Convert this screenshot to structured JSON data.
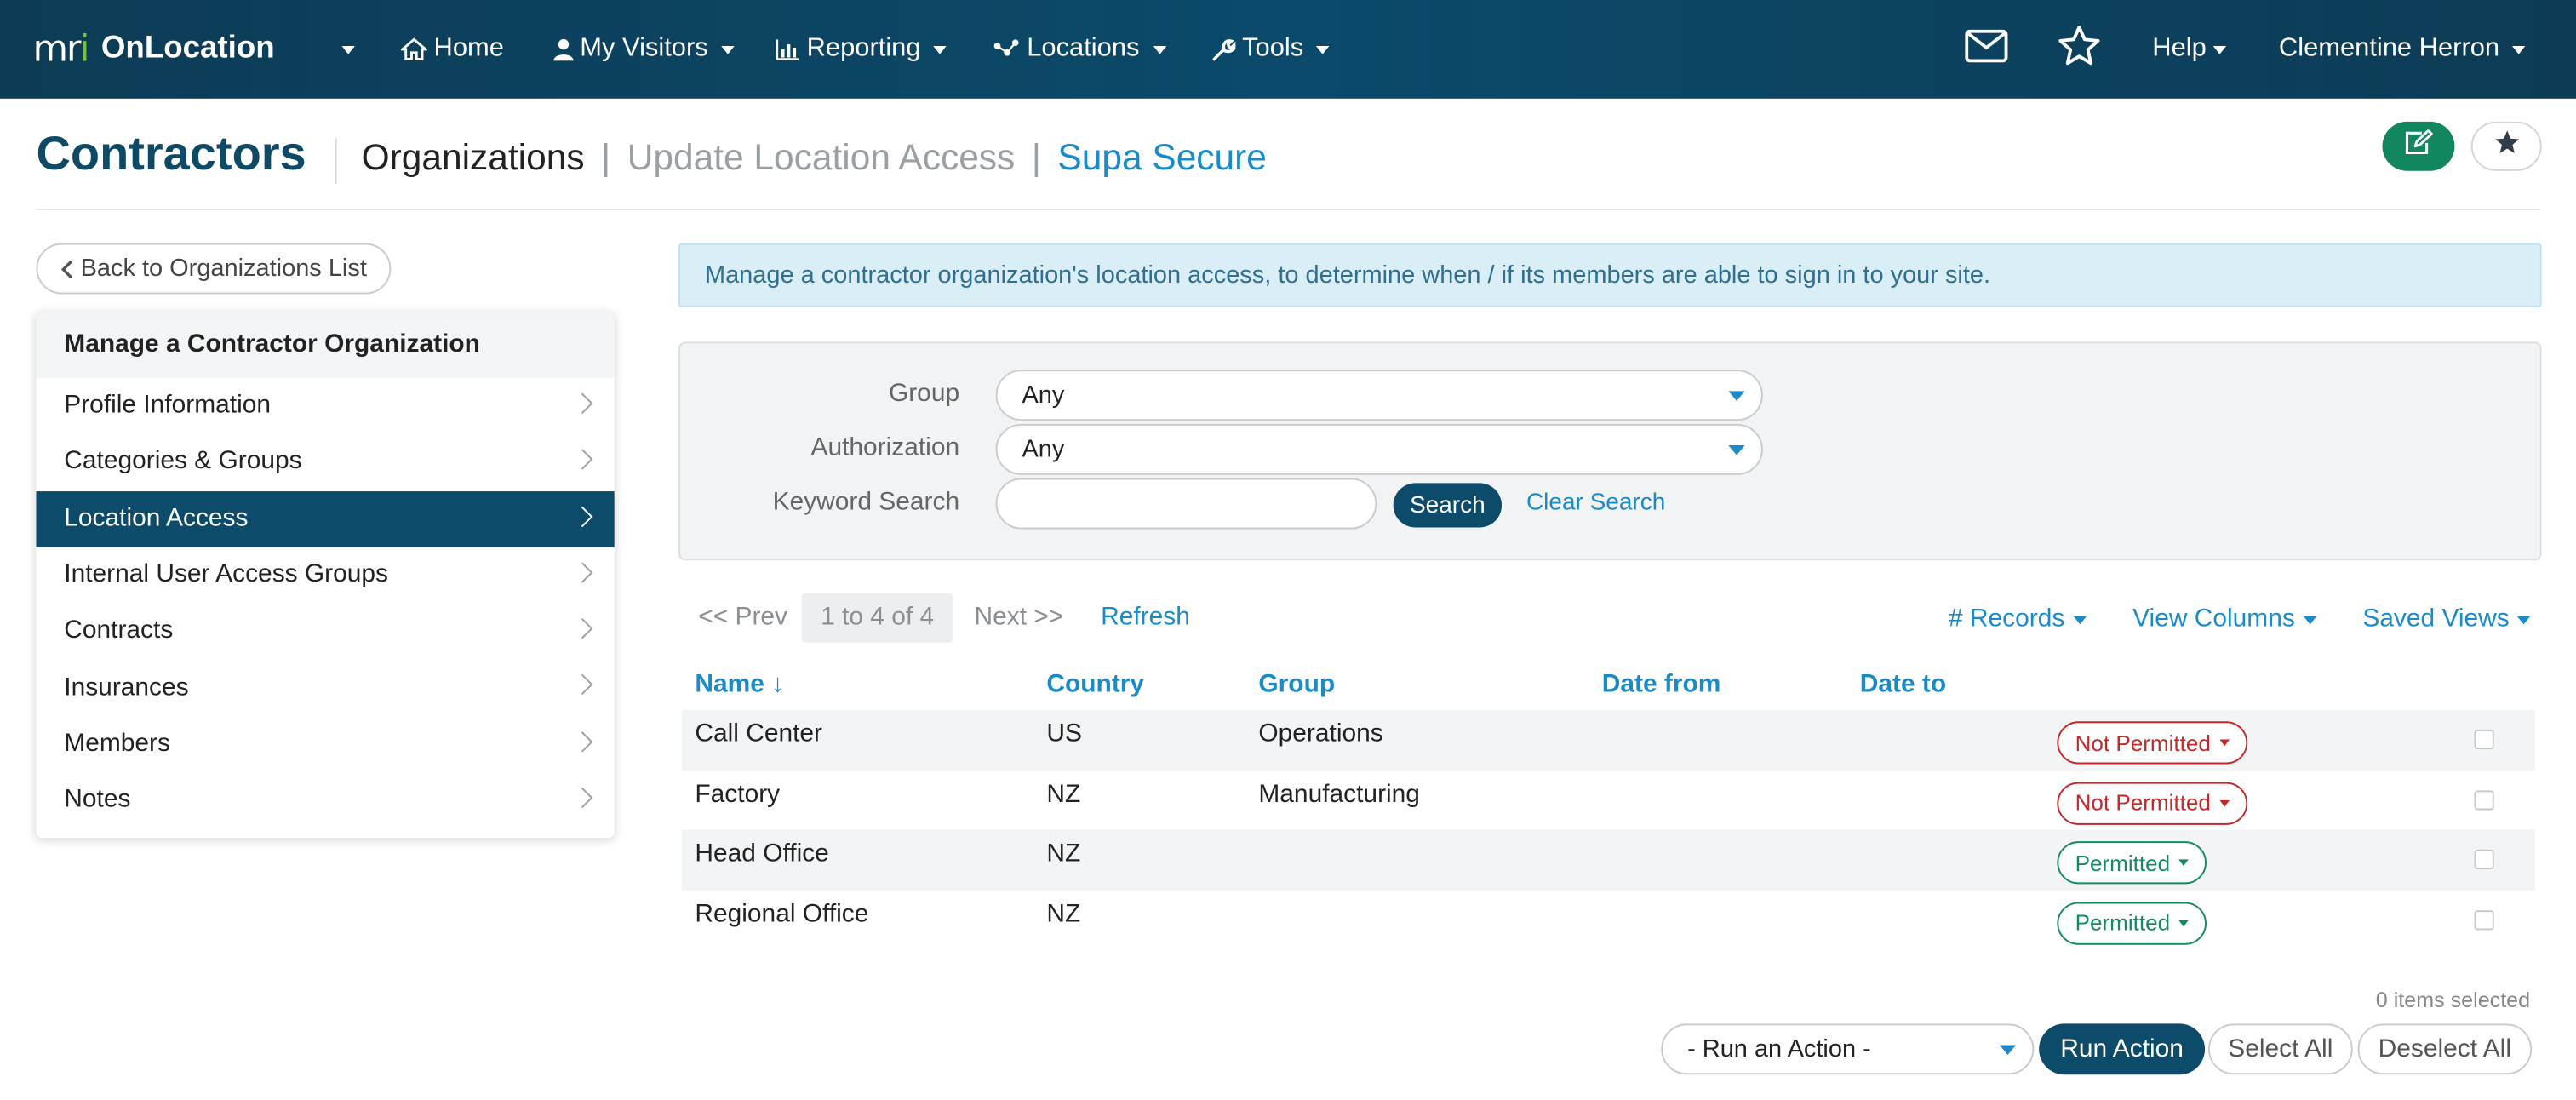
{
  "nav": {
    "brand_mark": "mri",
    "brand_name": "OnLocation",
    "items": [
      {
        "label": "Home",
        "icon": "home-icon"
      },
      {
        "label": "My Visitors",
        "icon": "user-icon"
      },
      {
        "label": "Reporting",
        "icon": "bar-chart-icon"
      },
      {
        "label": "Locations",
        "icon": "network-icon"
      },
      {
        "label": "Tools",
        "icon": "wrench-icon"
      }
    ],
    "help_label": "Help",
    "user_name": "Clementine Herron"
  },
  "header": {
    "title": "Contractors",
    "breadcrumb": [
      "Organizations",
      "Update Location Access",
      "Supa Secure"
    ],
    "separator": "|"
  },
  "sidebar": {
    "back_label": "Back to Organizations List",
    "panel_title": "Manage a Contractor Organization",
    "items": [
      {
        "label": "Profile Information",
        "active": false
      },
      {
        "label": "Categories & Groups",
        "active": false
      },
      {
        "label": "Location Access",
        "active": true
      },
      {
        "label": "Internal User Access Groups",
        "active": false
      },
      {
        "label": "Contracts",
        "active": false
      },
      {
        "label": "Insurances",
        "active": false
      },
      {
        "label": "Members",
        "active": false
      },
      {
        "label": "Notes",
        "active": false
      }
    ]
  },
  "info_text": "Manage a contractor organization's location access, to determine when / if its members are able to sign in to your site.",
  "filters": {
    "group_label": "Group",
    "group_value": "Any",
    "auth_label": "Authorization",
    "auth_value": "Any",
    "keyword_label": "Keyword Search",
    "keyword_value": "",
    "search_label": "Search",
    "clear_label": "Clear Search"
  },
  "pager": {
    "prev": "<< Prev",
    "info": "1 to 4 of 4",
    "next": "Next >>",
    "refresh": "Refresh",
    "records": "# Records",
    "view_columns": "View Columns",
    "saved_views": "Saved Views"
  },
  "table": {
    "columns": [
      "Name ↓",
      "Country",
      "Group",
      "Date from",
      "Date to"
    ],
    "rows": [
      {
        "name": "Call Center",
        "country": "US",
        "group": "Operations",
        "date_from": "",
        "date_to": "",
        "status": "Not Permitted",
        "permitted": false
      },
      {
        "name": "Factory",
        "country": "NZ",
        "group": "Manufacturing",
        "date_from": "",
        "date_to": "",
        "status": "Not Permitted",
        "permitted": false
      },
      {
        "name": "Head Office",
        "country": "NZ",
        "group": "",
        "date_from": "",
        "date_to": "",
        "status": "Permitted",
        "permitted": true
      },
      {
        "name": "Regional Office",
        "country": "NZ",
        "group": "",
        "date_from": "",
        "date_to": "",
        "status": "Permitted",
        "permitted": true
      }
    ]
  },
  "actions": {
    "selected_count": "0 items selected",
    "run_select": "- Run an Action -",
    "run": "Run Action",
    "select_all": "Select All",
    "deselect_all": "Deselect All"
  },
  "colors": {
    "nav_bg": "#0d3b55",
    "accent": "#1b8bc8",
    "primary_dark": "#0d4b6b",
    "danger": "#c62828",
    "success": "#138a67",
    "edit_button": "#11865f"
  }
}
